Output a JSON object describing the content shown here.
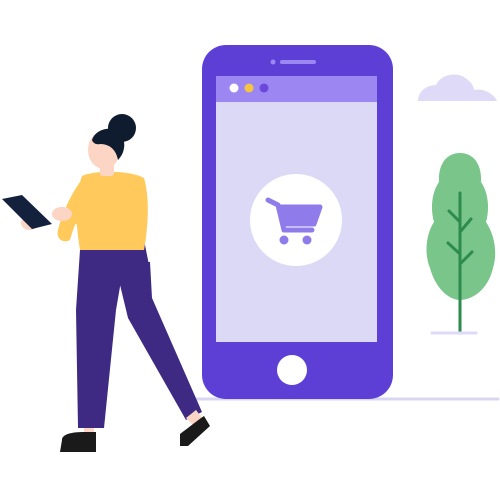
{
  "illustration": {
    "subject": "mobile-shopping",
    "icons": {
      "phone_screen_icon": "shopping-cart-icon",
      "plant": "tree-icon",
      "sky": "cloud-icon",
      "held_device": "tablet-icon"
    },
    "colors": {
      "phone_body": "#5E3FD6",
      "phone_screen": "#DCD9F7",
      "browser_bar": "#9B86F2",
      "cart_circle": "#FFFFFF",
      "cart": "#8F7BEA",
      "dot_white": "#FFFFFF",
      "dot_yellow": "#F5C542",
      "dot_purple": "#6A49D8",
      "tree_leaf": "#79C58A",
      "tree_trunk": "#2E8B4E",
      "cloud": "#DEDAF7",
      "ground": "#D9D6F2",
      "shirt": "#FFC95C",
      "pants": "#3E2A83",
      "skin": "#FCD5C4",
      "hair": "#0F1B2E",
      "shoes": "#1A1A1A",
      "tablet": "#14213D"
    }
  }
}
